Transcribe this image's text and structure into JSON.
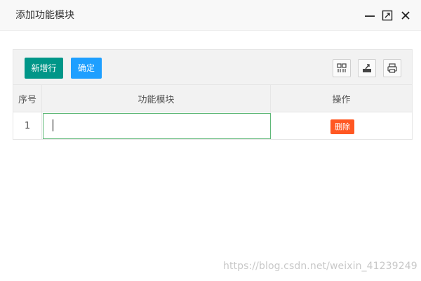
{
  "dialog": {
    "title": "添加功能模块",
    "controls": [
      "minimize-icon",
      "maximize-icon",
      "close-icon"
    ]
  },
  "toolbar": {
    "add_row_label": "新增行",
    "confirm_label": "确定",
    "icons": [
      "columns-icon",
      "export-icon",
      "print-icon"
    ]
  },
  "table": {
    "columns": [
      "序号",
      "功能模块",
      "操作"
    ],
    "rows": [
      {
        "index": "1",
        "module_value": "",
        "action_label": "删除"
      }
    ]
  },
  "colors": {
    "add_button": "#009688",
    "confirm_button": "#1e9fff",
    "delete_button": "#ff5722",
    "input_focus_border": "#5fb878"
  },
  "watermark": "https://blog.csdn.net/weixin_41239249"
}
